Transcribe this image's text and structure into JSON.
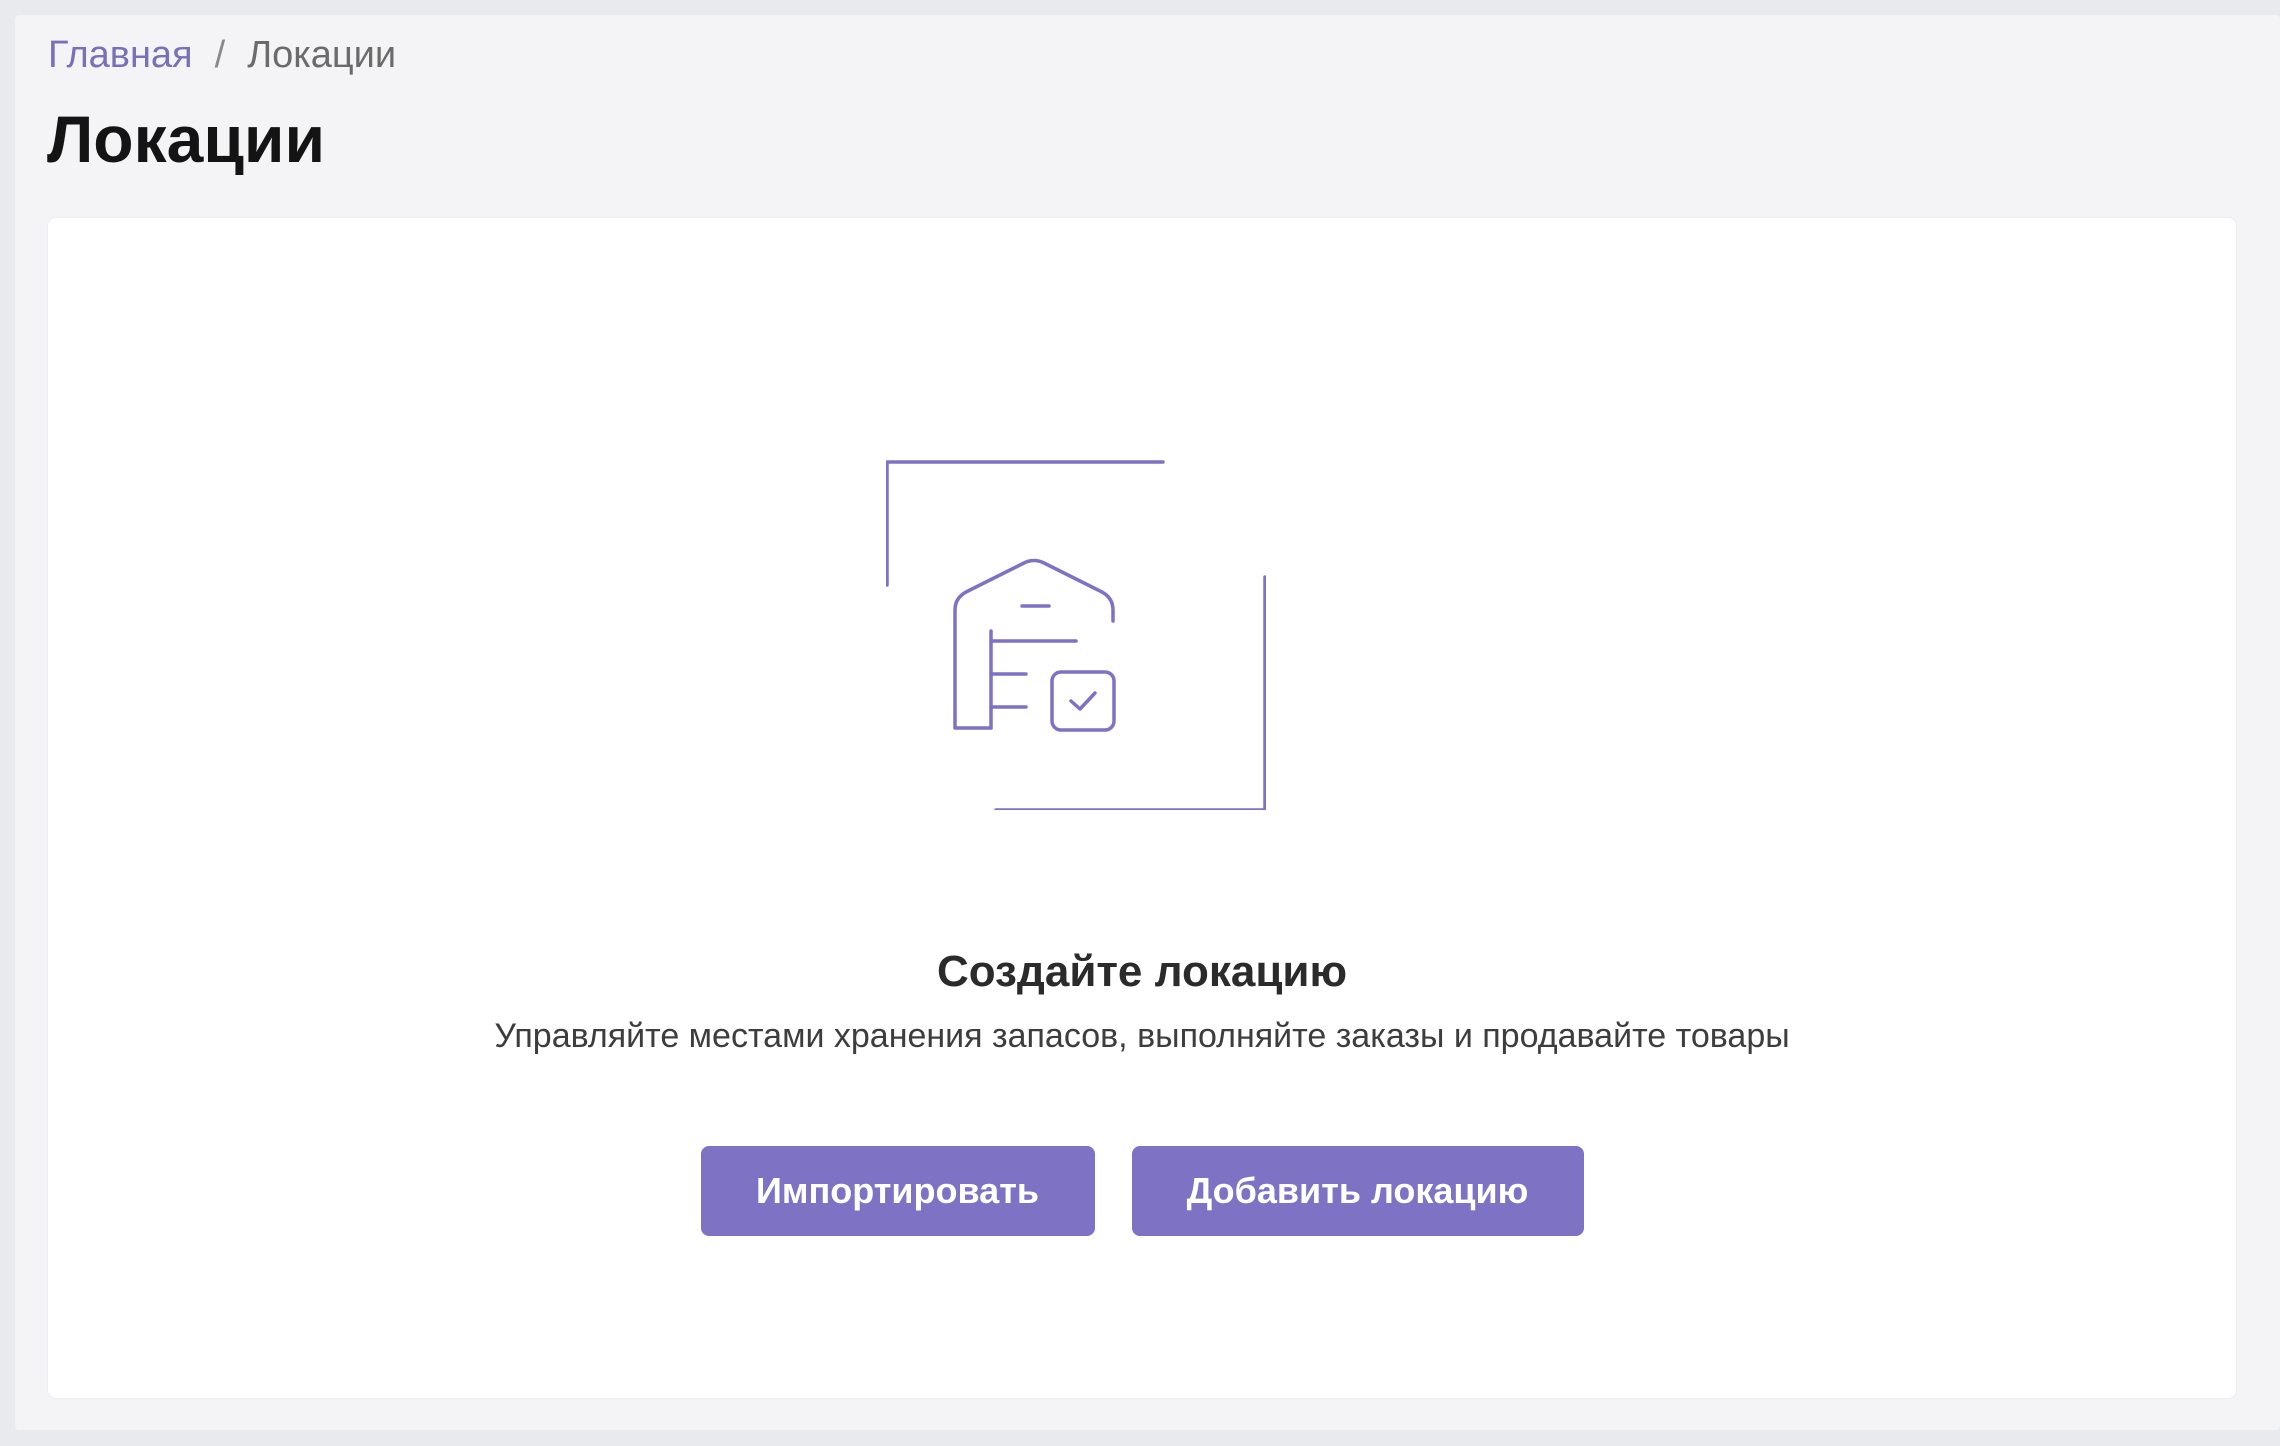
{
  "breadcrumb": {
    "home": "Главная",
    "separator": "/",
    "current": "Локации"
  },
  "page": {
    "title": "Локации"
  },
  "empty_state": {
    "illustration_icon": "warehouse-icon",
    "title": "Создайте локацию",
    "description": "Управляйте местами хранения запасов, выполняйте заказы и продавайте товары",
    "import_label": "Импортировать",
    "add_label": "Добавить локацию"
  },
  "colors": {
    "accent": "#7d72c3",
    "link": "#7a70b8",
    "background": "#f4f4f6",
    "card": "#ffffff"
  }
}
